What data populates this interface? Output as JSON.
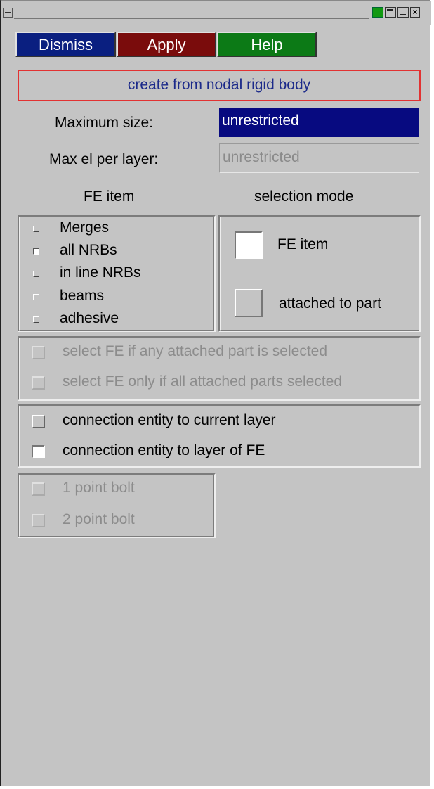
{
  "titlebar": {
    "close_glyph": "×"
  },
  "actions": {
    "dismiss": "Dismiss",
    "apply": "Apply",
    "help": "Help"
  },
  "create_mode": "create from nodal rigid body",
  "max_size": {
    "label": "Maximum size:",
    "value": "unrestricted"
  },
  "max_el_per_layer": {
    "label": "Max el per layer:",
    "value": "unrestricted"
  },
  "headers": {
    "fe_item": "FE item",
    "selection_mode": "selection mode"
  },
  "fe_items": [
    {
      "label": "Merges",
      "selected": false
    },
    {
      "label": "all NRBs",
      "selected": true
    },
    {
      "label": "in line NRBs",
      "selected": false
    },
    {
      "label": "beams",
      "selected": false
    },
    {
      "label": "adhesive",
      "selected": false
    }
  ],
  "selection_modes": [
    {
      "label": "FE item",
      "selected": true
    },
    {
      "label": "attached to part",
      "selected": false
    }
  ],
  "attached_options": [
    {
      "label": "select FE if any attached part is selected",
      "enabled": false
    },
    {
      "label": "select FE only if all attached parts selected",
      "enabled": false
    }
  ],
  "layer_options": [
    {
      "label": "connection entity to current layer",
      "selected": false
    },
    {
      "label": "connection entity to layer of FE",
      "selected": true
    }
  ],
  "bolt_options": [
    {
      "label": "1 point bolt",
      "enabled": false
    },
    {
      "label": "2 point bolt",
      "enabled": false
    }
  ],
  "colors": {
    "panel_bg": "#c4c4c4",
    "dismiss_bg": "#0a1f80",
    "apply_bg": "#7a0c0c",
    "help_bg": "#0c7a16",
    "highlight_field": "#070a80",
    "create_border": "#e23232"
  }
}
